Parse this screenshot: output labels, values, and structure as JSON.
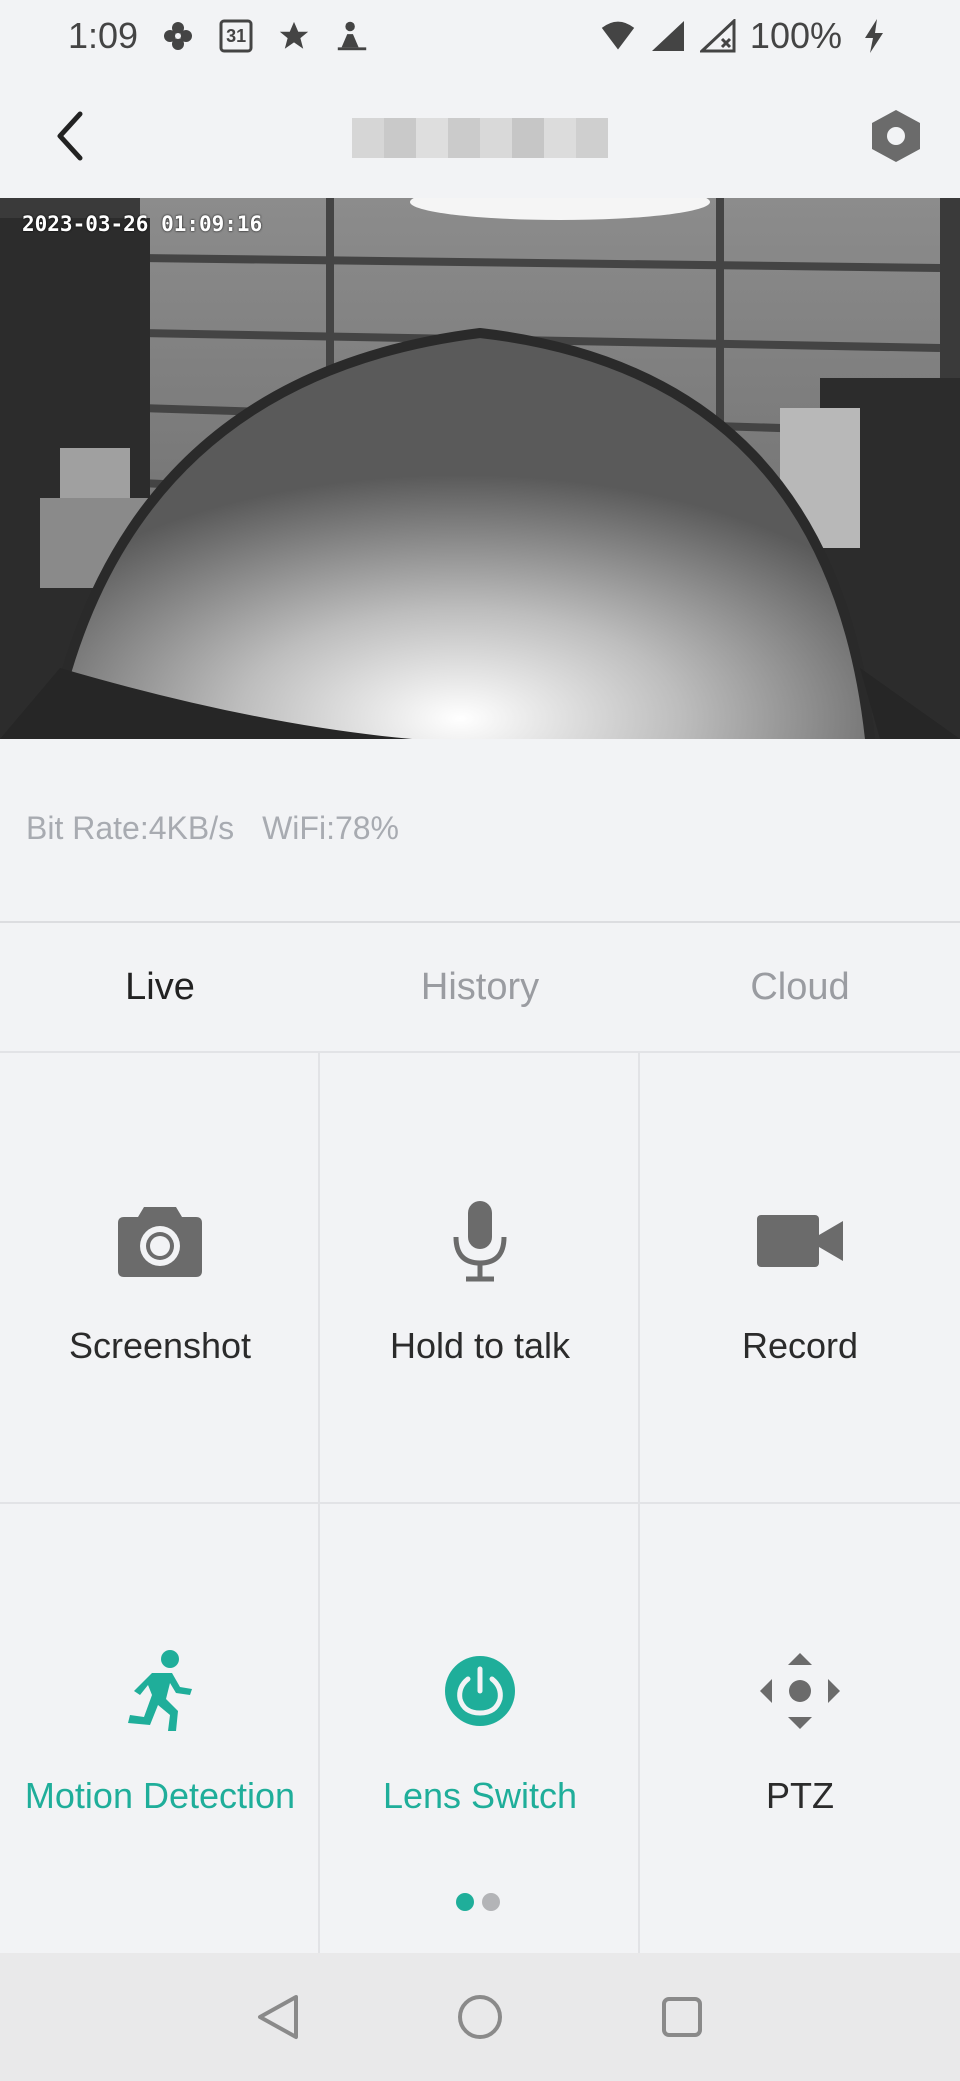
{
  "status_bar": {
    "time": "1:09",
    "calendar_day": "31",
    "battery": "100%"
  },
  "camera": {
    "timestamp": "2023-03-26 01:09:16"
  },
  "stats": {
    "bit_rate": "Bit Rate:4KB/s",
    "wifi": "WiFi:78%"
  },
  "tabs": [
    {
      "label": "Live",
      "active": true
    },
    {
      "label": "History",
      "active": false
    },
    {
      "label": "Cloud",
      "active": false
    }
  ],
  "actions": [
    {
      "label": "Screenshot",
      "icon": "camera-icon"
    },
    {
      "label": "Hold to talk",
      "icon": "microphone-icon"
    },
    {
      "label": "Record",
      "icon": "video-camera-icon"
    },
    {
      "label": "Motion Detection",
      "icon": "running-person-icon",
      "accent": true
    },
    {
      "label": "Lens Switch",
      "icon": "power-icon",
      "accent": true
    },
    {
      "label": "PTZ",
      "icon": "ptz-arrows-icon"
    }
  ],
  "pager": {
    "pages": 2,
    "current": 1
  },
  "colors": {
    "accent": "#1fae9a",
    "icon_gray": "#6b6b6b",
    "background": "#f2f3f5"
  }
}
